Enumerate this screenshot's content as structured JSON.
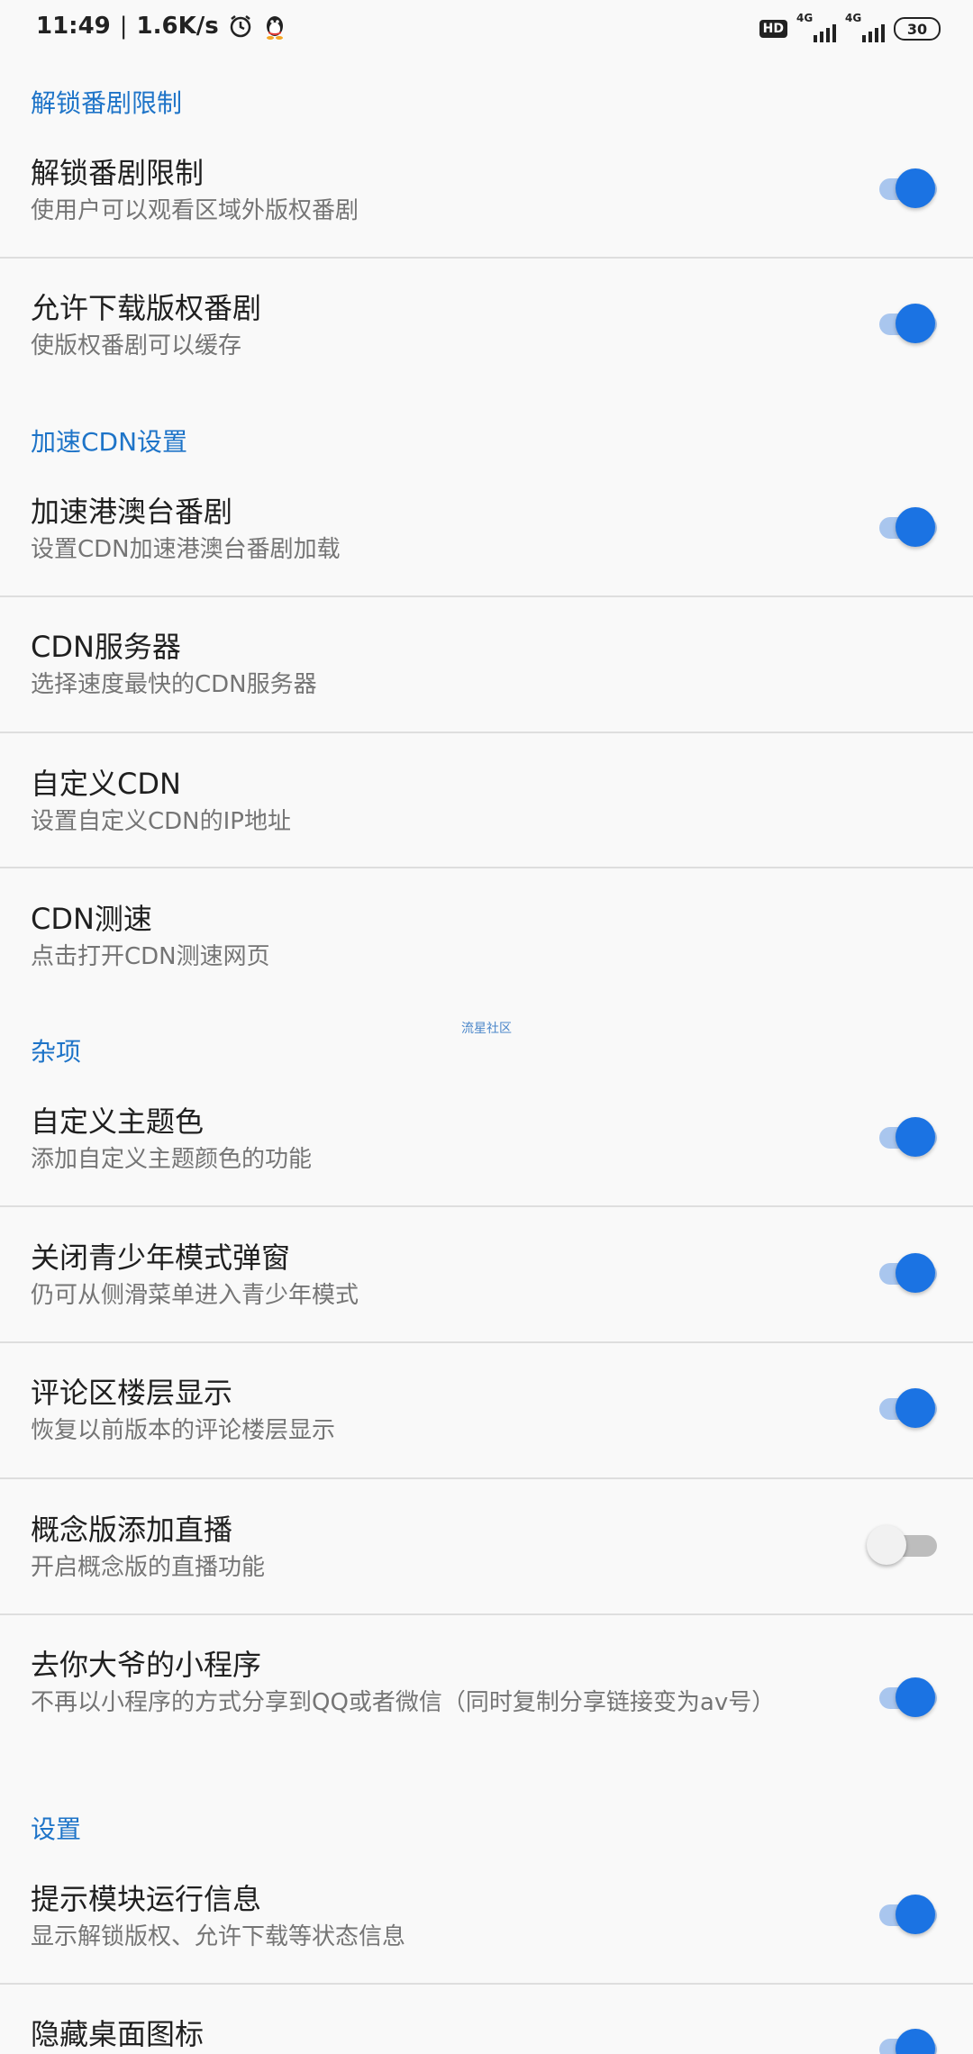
{
  "status_bar": {
    "time": "11:49",
    "speed": "1.6K/s",
    "network1": "4G",
    "network2": "4G",
    "hd_badge": "HD",
    "battery": "30",
    "icons": [
      "alarm-icon",
      "qq-penguin-icon",
      "signal-icon",
      "battery-icon"
    ]
  },
  "watermark": "流星社区",
  "sections": [
    {
      "header": "解锁番剧限制",
      "items": [
        {
          "title": "解锁番剧限制",
          "summary": "使用户可以观看区域外版权番剧",
          "switch": true
        },
        {
          "title": "允许下载版权番剧",
          "summary": "使版权番剧可以缓存",
          "switch": true
        }
      ]
    },
    {
      "header": "加速CDN设置",
      "items": [
        {
          "title": "加速港澳台番剧",
          "summary": "设置CDN加速港澳台番剧加载",
          "switch": true
        },
        {
          "title": "CDN服务器",
          "summary": "选择速度最快的CDN服务器"
        },
        {
          "title": "自定义CDN",
          "summary": "设置自定义CDN的IP地址"
        },
        {
          "title": "CDN测速",
          "summary": "点击打开CDN测速网页"
        }
      ]
    },
    {
      "header": "杂项",
      "items": [
        {
          "title": "自定义主题色",
          "summary": "添加自定义主题颜色的功能",
          "switch": true
        },
        {
          "title": "关闭青少年模式弹窗",
          "summary": "仍可从侧滑菜单进入青少年模式",
          "switch": true
        },
        {
          "title": "评论区楼层显示",
          "summary": "恢复以前版本的评论楼层显示",
          "switch": true
        },
        {
          "title": "概念版添加直播",
          "summary": "开启概念版的直播功能",
          "switch": false
        },
        {
          "title": "去你大爷的小程序",
          "summary": "不再以小程序的方式分享到QQ或者微信（同时复制分享链接变为av号）",
          "switch": true
        }
      ]
    },
    {
      "header": "设置",
      "items": [
        {
          "title": "提示模块运行信息",
          "summary": "显示解锁版权、允许下载等状态信息",
          "switch": true
        },
        {
          "title": "隐藏桌面图标",
          "summary": "",
          "switch": true
        }
      ]
    }
  ],
  "colors": {
    "accent": "#1b73e3",
    "section_header": "#1e74c8",
    "switch_track_on": "#a9c6ee",
    "divider": "#dedede",
    "background": "#f9f9f9"
  }
}
